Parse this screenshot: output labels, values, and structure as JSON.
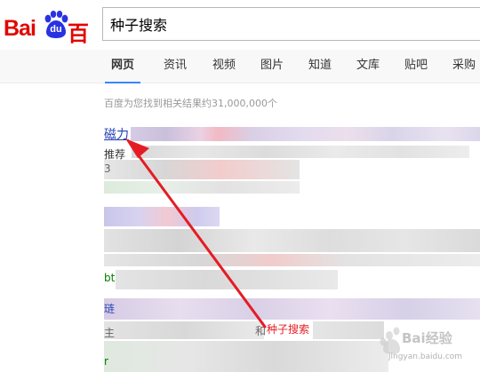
{
  "logo": {
    "latin": "Bai",
    "badge": "du",
    "chinese": "百度"
  },
  "search": {
    "query": "种子搜索"
  },
  "nav": {
    "tabs": [
      {
        "label": "网页",
        "active": true
      },
      {
        "label": "资讯",
        "active": false
      },
      {
        "label": "视频",
        "active": false
      },
      {
        "label": "图片",
        "active": false
      },
      {
        "label": "知道",
        "active": false
      },
      {
        "label": "文库",
        "active": false
      },
      {
        "label": "贴吧",
        "active": false
      },
      {
        "label": "采购",
        "active": false
      }
    ]
  },
  "results": {
    "count_text": "百度为您找到相关结果约31,000,000个",
    "first_title_fragment": "磁力",
    "first_snippet_fragment": "推荐",
    "fragment_bt": "bt",
    "fragment_3": "3",
    "fragment_lian": "琏",
    "fragment_zhu": "主",
    "fragment_he": "和",
    "fragment_r": "r"
  },
  "annotation": {
    "label": "种子搜索"
  },
  "watermark": {
    "name": "Bai经验",
    "url": "jingyan.baidu.com"
  },
  "colors": {
    "baidu_red": "#e10601",
    "baidu_blue": "#2932e1",
    "link_blue": "#2440b3",
    "active_tab_underline": "#3388ff",
    "annotation_red": "#e51c23"
  }
}
